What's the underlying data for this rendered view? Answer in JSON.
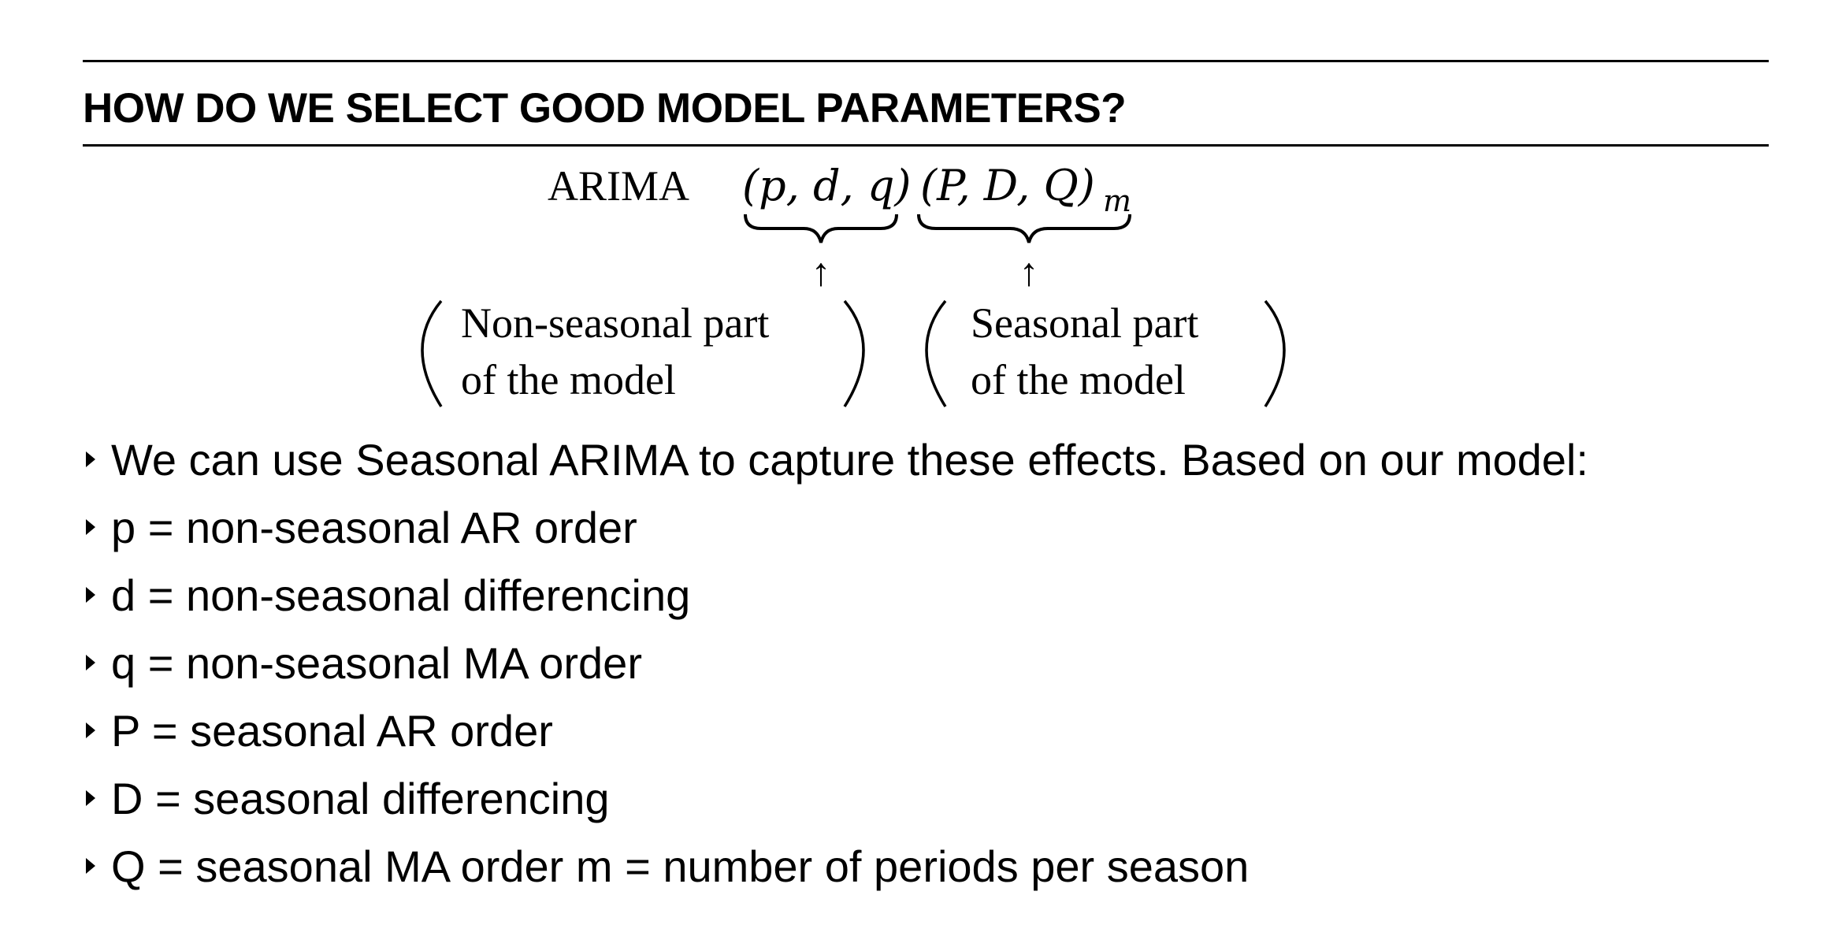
{
  "title": "HOW DO WE SELECT GOOD MODEL PARAMETERS?",
  "formula": {
    "model_name": "ARIMA",
    "nonseasonal_params": "(p, d, q)",
    "seasonal_params": "(P, D, Q)",
    "seasonal_subscript": "m",
    "arrow": "↑",
    "nonseasonal_label_line1": "Non-seasonal part",
    "nonseasonal_label_line2": "of the model",
    "seasonal_label_line1": "Seasonal part",
    "seasonal_label_line2": "of the model"
  },
  "bullets": [
    "We can use Seasonal ARIMA to capture these effects. Based on our model:",
    "p = non-seasonal AR order",
    "d = non-seasonal differencing",
    "q = non-seasonal MA order",
    "P = seasonal AR order",
    "D = seasonal differencing",
    "Q = seasonal MA order m = number of periods per season"
  ]
}
